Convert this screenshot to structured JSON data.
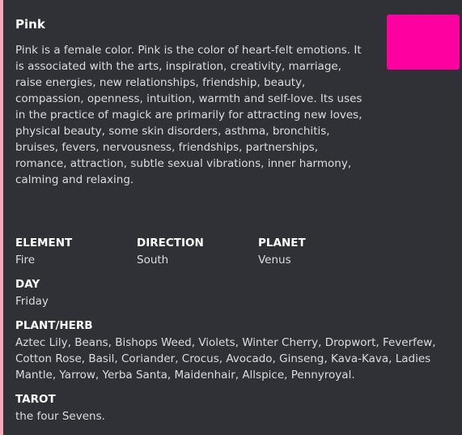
{
  "embed": {
    "accent_color": "#f4aab9",
    "title": "Pink",
    "thumbnail_color": "#ff00a0",
    "description": "Pink is a female color. Pink is the color of heart-felt emotions. It is associated with the arts, inspiration, creativity, marriage, raise energies, new relationships, friendship, beauty, compassion, openness, intuition, warmth and self-love. Its uses in the practice of magick are primarily for attracting new loves, physical beauty, some skin disorders, asthma, bronchitis, bruises, fevers, nervousness, friendships, partnerships, romance, attraction, subtle sexual vibrations, inner harmony, calming and relaxing.",
    "fields": {
      "element": {
        "name": "ELEMENT",
        "value": "Fire"
      },
      "direction": {
        "name": "DIRECTION",
        "value": "South"
      },
      "planet": {
        "name": "PLANET",
        "value": "Venus"
      },
      "day": {
        "name": "DAY",
        "value": "Friday"
      },
      "plant_herb": {
        "name": "PLANT/HERB",
        "value": "Aztec Lily, Beans, Bishops Weed, Violets, Winter Cherry, Dropwort, Feverfew, Cotton Rose, Basil, Coriander, Crocus, Avocado, Ginseng, Kava-Kava, Ladies Mantle, Yarrow, Yerba Santa, Maidenhair, Allspice, Pennyroyal."
      },
      "tarot": {
        "name": "TAROT",
        "value": "the four Sevens."
      }
    }
  }
}
